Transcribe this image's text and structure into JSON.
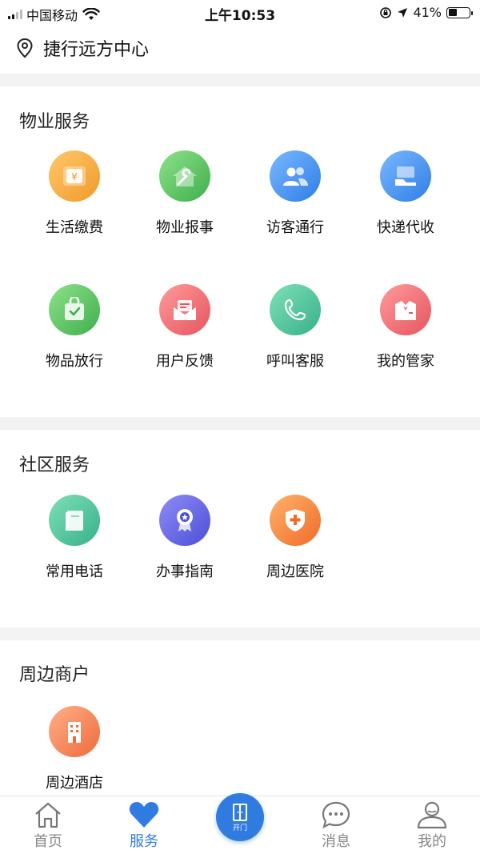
{
  "status_bar": {
    "carrier": "中国移动",
    "time": "上午10:53",
    "battery": "41%"
  },
  "location": {
    "name": "捷行远方中心"
  },
  "sections": {
    "property": {
      "title": "物业服务",
      "items": [
        {
          "label": "生活缴费",
          "icon": "payment-icon"
        },
        {
          "label": "物业报事",
          "icon": "repair-icon"
        },
        {
          "label": "访客通行",
          "icon": "visitors-icon"
        },
        {
          "label": "快递代收",
          "icon": "parcel-icon"
        },
        {
          "label": "物品放行",
          "icon": "item-release-icon"
        },
        {
          "label": "用户反馈",
          "icon": "feedback-icon"
        },
        {
          "label": "呼叫客服",
          "icon": "phone-icon"
        },
        {
          "label": "我的管家",
          "icon": "butler-icon"
        }
      ]
    },
    "community": {
      "title": "社区服务",
      "items": [
        {
          "label": "常用电话",
          "icon": "phonebook-icon"
        },
        {
          "label": "办事指南",
          "icon": "guide-badge-icon"
        },
        {
          "label": "周边医院",
          "icon": "hospital-icon"
        }
      ]
    },
    "merchants": {
      "title": "周边商户",
      "items": [
        {
          "label": "周边酒店",
          "icon": "hotel-icon"
        }
      ]
    }
  },
  "tabbar": {
    "tabs": [
      {
        "label": "首页",
        "icon": "home-icon"
      },
      {
        "label": "服务",
        "icon": "heart-icon"
      },
      {
        "label": "开门",
        "icon": "door-icon"
      },
      {
        "label": "消息",
        "icon": "message-icon"
      },
      {
        "label": "我的",
        "icon": "user-icon"
      }
    ],
    "active": "服务"
  },
  "colors": {
    "accent": "#2f7be0",
    "text": "#111111",
    "divider": "#f3f3f3"
  }
}
